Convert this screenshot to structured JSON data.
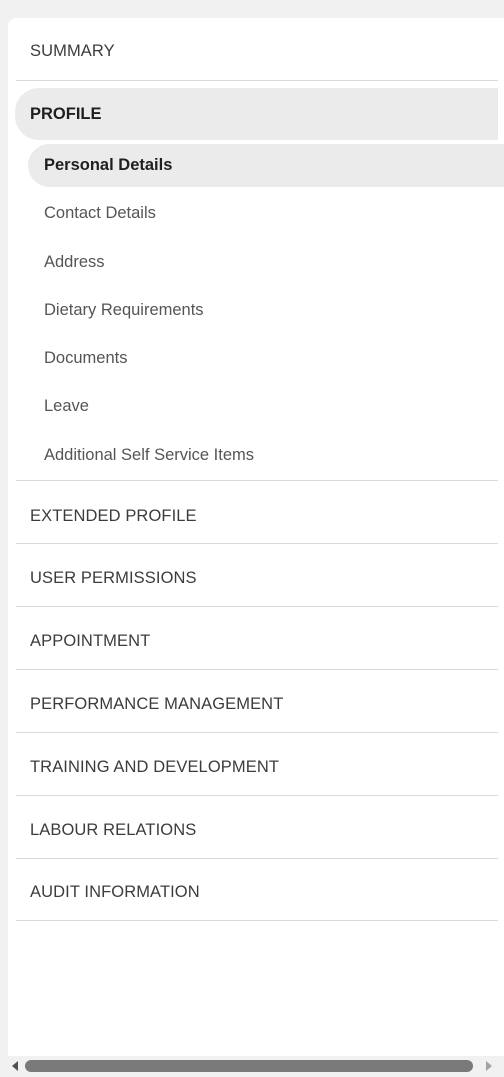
{
  "nav": {
    "summary": "SUMMARY",
    "profile": "PROFILE",
    "profile_items": [
      "Personal Details",
      "Contact Details",
      "Address",
      "Dietary Requirements",
      "Documents",
      "Leave",
      "Additional Self Service Items"
    ],
    "extended_profile": "EXTENDED PROFILE",
    "user_permissions": "USER PERMISSIONS",
    "appointment": "APPOINTMENT",
    "performance_management": "PERFORMANCE MANAGEMENT",
    "training_and_development": "TRAINING AND DEVELOPMENT",
    "labour_relations": "LABOUR RELATIONS",
    "audit_information": "AUDIT INFORMATION"
  },
  "scrollbar": {
    "left_icon": "arrow-left-icon",
    "right_icon": "arrow-right-icon"
  }
}
